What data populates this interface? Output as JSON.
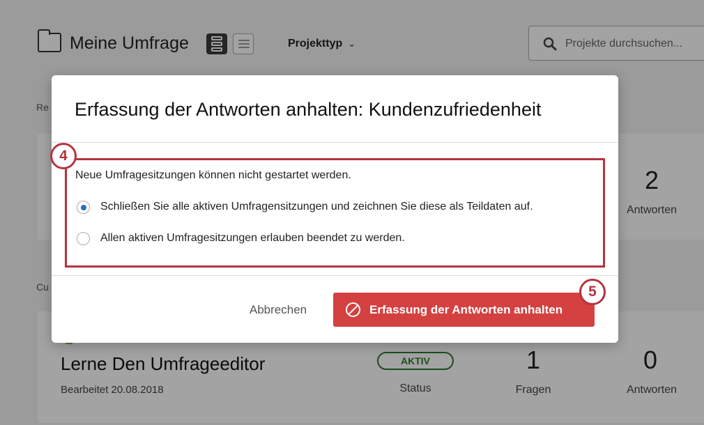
{
  "page": {
    "title": "Meine Umfrage",
    "filter_label": "Projekttyp",
    "search_placeholder": "Projekte durchsuchen..."
  },
  "sections": {
    "recent_label": "Re",
    "current_label": "Cu"
  },
  "card1": {
    "responses_count": "2",
    "responses_label": "Antworten"
  },
  "card2": {
    "survey_name": "Lerne Den Umfrageeditor",
    "edited": "Bearbeitet 20.08.2018",
    "status_value": "AKTIV",
    "status_label": "Status",
    "questions_count": "1",
    "questions_label": "Fragen",
    "responses_count": "0",
    "responses_label": "Antworten"
  },
  "modal": {
    "title": "Erfassung der Antworten anhalten: Kundenzufriedenheit",
    "intro": "Neue Umfragesitzungen können nicht gestartet werden.",
    "options": [
      {
        "label": "Schließen Sie alle aktiven Umfragensitzungen und zeichnen Sie diese als Teildaten auf.",
        "checked": true
      },
      {
        "label": "Allen aktiven Umfragesitzungen erlauben beendet zu werden.",
        "checked": false
      }
    ],
    "cancel_label": "Abbrechen",
    "confirm_label": "Erfassung der Antworten anhalten",
    "step_badges": [
      "4",
      "5"
    ]
  },
  "colors": {
    "accent_red": "#d34141",
    "highlight_red": "#b5333e",
    "radio_blue": "#2a6ebb",
    "status_green": "#2d7a2f"
  },
  "icons": [
    "folder-icon",
    "list-view-icon",
    "compact-view-icon",
    "chevron-down-icon",
    "search-icon",
    "leaf-icon",
    "stop-icon"
  ]
}
